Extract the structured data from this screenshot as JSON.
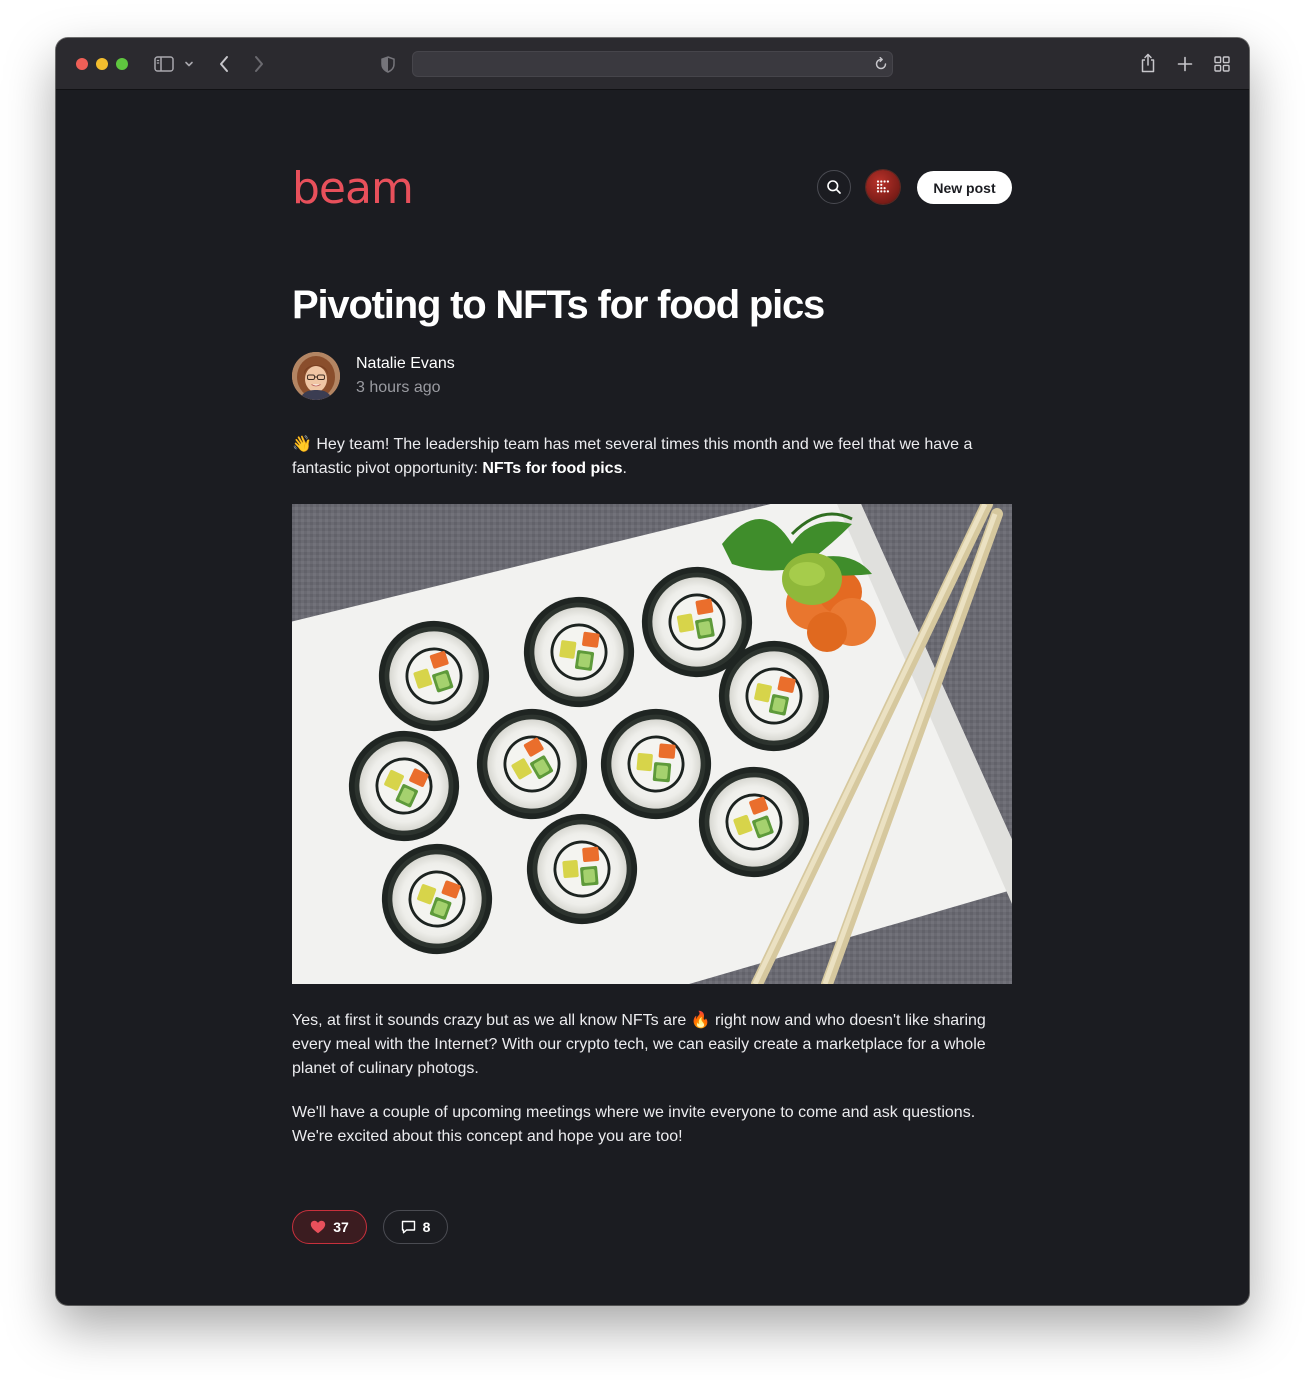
{
  "browser": {
    "url": "",
    "icons": [
      "sidebar-icon",
      "chevron-down-icon",
      "back-icon",
      "forward-icon",
      "shield-icon",
      "reload-icon",
      "share-icon",
      "plus-icon",
      "tab-overview-icon"
    ]
  },
  "app": {
    "logo": "beam",
    "brand_color": "#e8505b",
    "new_post_label": "New post"
  },
  "post": {
    "title": "Pivoting to NFTs for food pics",
    "author": "Natalie Evans",
    "time": "3 hours ago",
    "intro_emoji": "👋",
    "intro_text": " Hey team! The leadership team has met several times this month and we feel that we have a fantastic pivot opportunity: ",
    "intro_bold": "NFTs for food pics",
    "intro_end": ".",
    "p2_a": "Yes, at first it sounds crazy but as we all know NFTs are ",
    "p2_emoji": "🔥",
    "p2_b": " right now and who doesn't like sharing every meal with the Internet? With our crypto tech, we can easily create a marketplace for a whole planet of culinary photogs.",
    "p3": "We'll have a couple of upcoming meetings where we invite everyone to come and ask questions. We're excited about this concept and hope you are too!",
    "image_subject": "sushi rolls on a white plate with chopsticks",
    "likes": "37",
    "comments": "8",
    "like_color": "#c8303c"
  }
}
